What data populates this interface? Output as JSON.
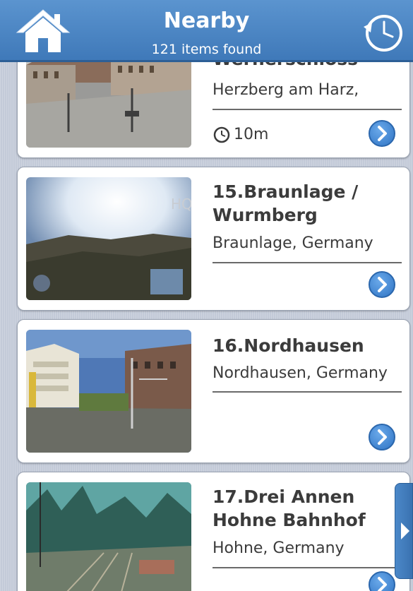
{
  "header": {
    "title": "Nearby",
    "subtitle": "121 items found",
    "home_icon": "home-icon",
    "history_icon": "clock-history-icon",
    "color": "#4d86c4"
  },
  "items": [
    {
      "title": "Wernerschloss",
      "location": "Herzberg am Harz,",
      "time": "10m",
      "thumb_icon": "webcam-image"
    },
    {
      "title": "15.Braunlage / Wurmberg",
      "location": "Braunlage, Germany",
      "thumb_text": "HQ",
      "thumb_icon": "webcam-image"
    },
    {
      "title": "16.Nordhausen",
      "location": "Nordhausen, Germany",
      "thumb_icon": "webcam-image"
    },
    {
      "title": "17.Drei Annen Hohne Bahnhof",
      "location": "Hohne, Germany",
      "thumb_icon": "webcam-image"
    }
  ],
  "go_icon": "chevron-right-icon",
  "side_tab_icon": "arrow-right-icon"
}
